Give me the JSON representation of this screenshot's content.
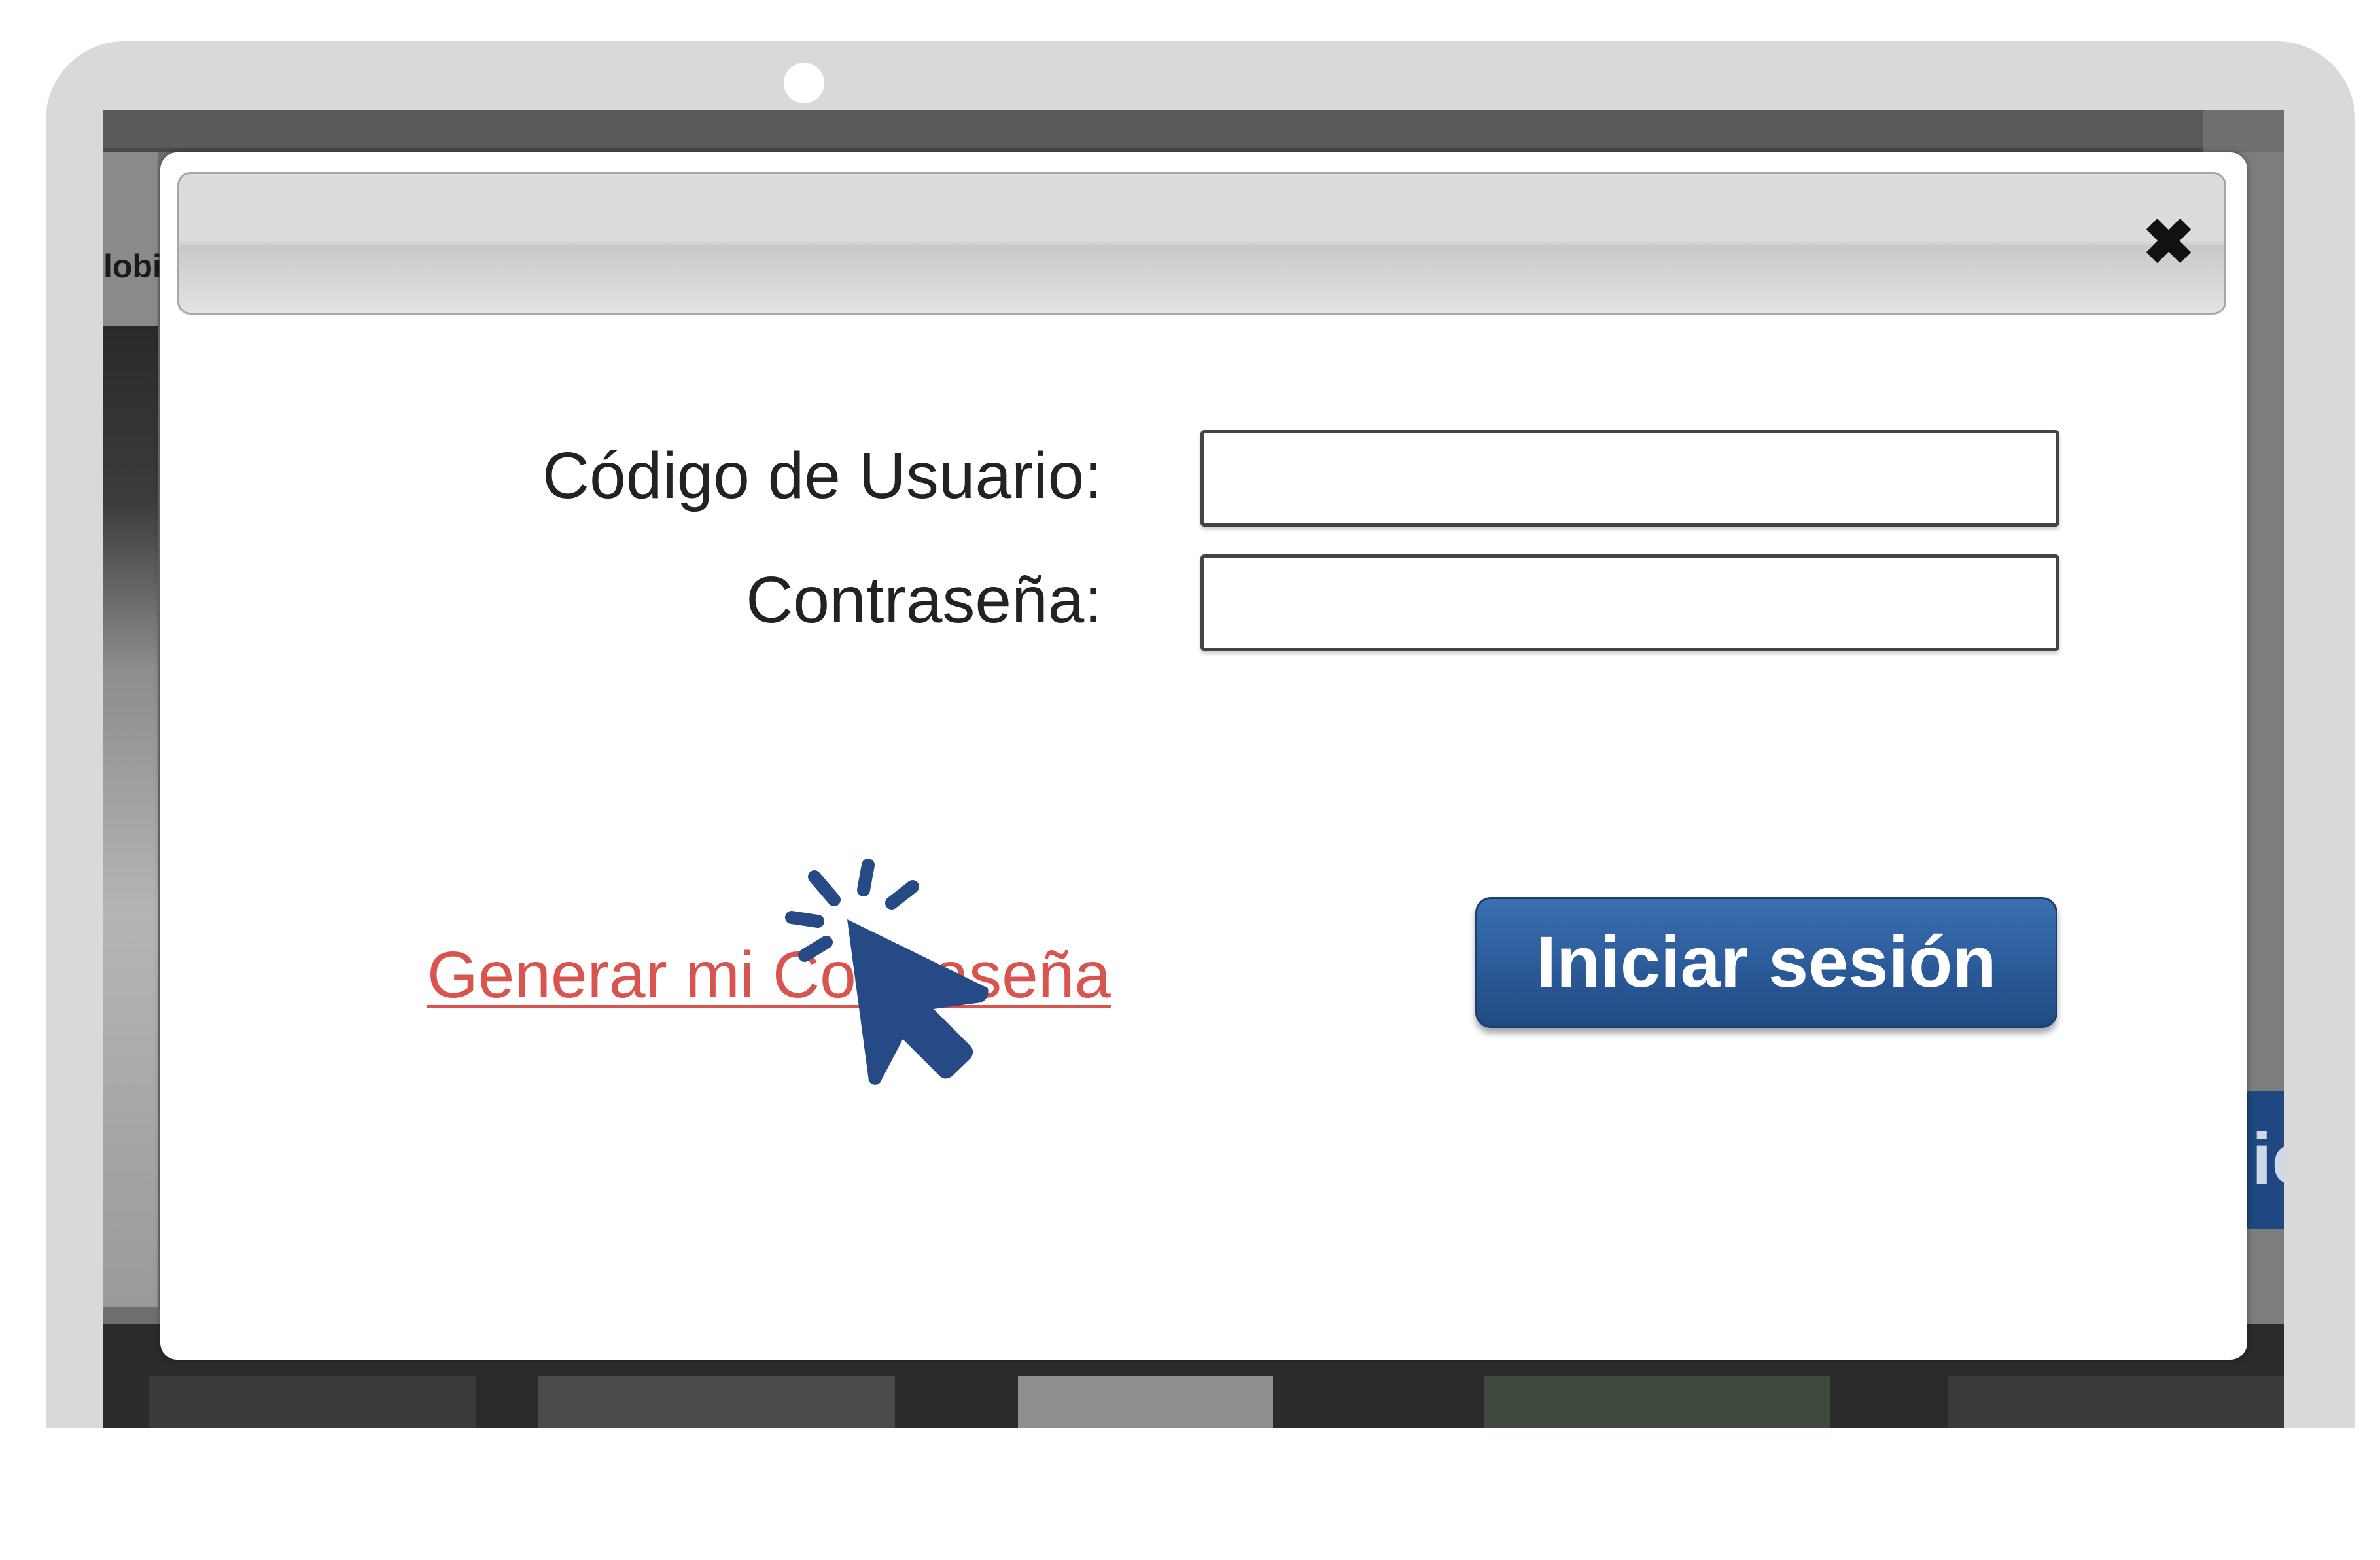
{
  "modal": {
    "close_glyph": "✖",
    "username_label": "Código de Usuario:",
    "password_label": "Contraseña:",
    "username_value": "",
    "password_value": "",
    "generate_password_link": "Generar mi Contraseña",
    "login_button": "Iniciar sesión"
  },
  "background": {
    "left_text_fragment": "lobi",
    "right_button_fragment": "ic"
  },
  "colors": {
    "link": "#d9534f",
    "button": "#2c5c9b",
    "cursor": "#254a85"
  },
  "icons": {
    "close": "close-icon",
    "cursor": "click-cursor-icon"
  }
}
